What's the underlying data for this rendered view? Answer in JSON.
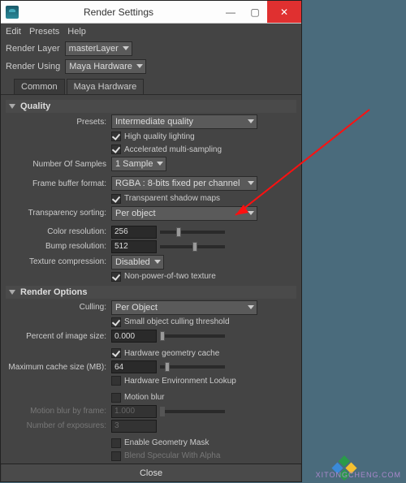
{
  "window": {
    "title": "Render Settings",
    "buttons": {
      "min": "—",
      "max": "▢",
      "close": "✕"
    }
  },
  "menubar": {
    "edit": "Edit",
    "presets": "Presets",
    "help": "Help"
  },
  "render_layer": {
    "label": "Render Layer",
    "value": "masterLayer"
  },
  "render_using": {
    "label": "Render Using",
    "value": "Maya Hardware"
  },
  "tabs": {
    "common": "Common",
    "hw": "Maya Hardware"
  },
  "quality": {
    "title": "Quality",
    "presets_label": "Presets:",
    "presets_value": "Intermediate quality",
    "hq_lighting": "High quality lighting",
    "ams": "Accelerated multi-sampling",
    "num_samples_label": "Number Of Samples",
    "num_samples_value": "1 Sample",
    "fbf_label": "Frame buffer format:",
    "fbf_value": "RGBA : 8-bits fixed per channel",
    "tsm": "Transparent shadow maps",
    "ts_label": "Transparency sorting:",
    "ts_value": "Per object",
    "cres_label": "Color resolution:",
    "cres_value": "256",
    "bres_label": "Bump resolution:",
    "bres_value": "512",
    "tc_label": "Texture compression:",
    "tc_value": "Disabled",
    "npot": "Non-power-of-two texture"
  },
  "render_options": {
    "title": "Render Options",
    "culling_label": "Culling:",
    "culling_value": "Per Object",
    "soct": "Small object culling threshold",
    "pois_label": "Percent of image size:",
    "pois_value": "0.000",
    "hgc": "Hardware geometry cache",
    "mcs_label": "Maximum cache size (MB):",
    "mcs_value": "64",
    "hel": "Hardware Environment Lookup",
    "mb": "Motion blur",
    "mbbf_label": "Motion blur by frame:",
    "mbbf_value": "1.000",
    "noe_label": "Number of exposures:",
    "noe_value": "3",
    "egm": "Enable Geometry Mask",
    "bswa": "Blend Specular With Alpha"
  },
  "footer": {
    "close": "Close"
  },
  "watermark": "XITONGCHENG.COM"
}
